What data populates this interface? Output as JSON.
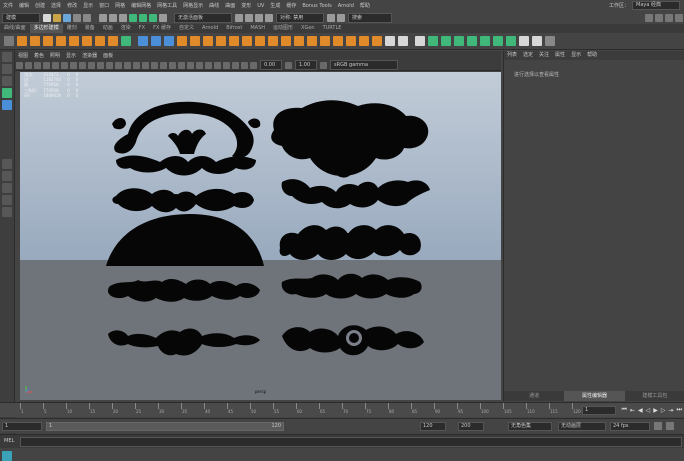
{
  "menubar": {
    "items": [
      "文件",
      "编辑",
      "创建",
      "选择",
      "修改",
      "显示",
      "窗口",
      "网格",
      "编辑网格",
      "网格工具",
      "网格显示",
      "曲线",
      "曲面",
      "变形",
      "UV",
      "生成",
      "缓存",
      "Bonus Tools",
      "Arnold",
      "帮助"
    ],
    "workspace_label": "工作区：",
    "workspace_value": "Maya 经典"
  },
  "statusline": {
    "mode": "建模",
    "unlock_label": "无激活面板",
    "render_label": "对称: 禁用",
    "search_placeholder": "搜索"
  },
  "shelf": {
    "tabs": [
      "曲线/曲面",
      "多边形建模",
      "雕刻",
      "装备",
      "动画",
      "渲染",
      "FX",
      "FX 缓存",
      "自定义",
      "Arnold",
      "Bifrost",
      "MASH",
      "运动图形",
      "XGen",
      "TURTLE"
    ],
    "active_tab": 1
  },
  "viewport": {
    "menu": [
      "视图",
      "着色",
      "照明",
      "显示",
      "渲染器",
      "面板"
    ],
    "field1": "0.00",
    "field2": "1.00",
    "colorspace": "sRGB gamma",
    "camera": "persp",
    "stats": [
      {
        "label": "顶点:",
        "a": "414872",
        "b": "0",
        "c": "0"
      },
      {
        "label": "边:",
        "a": "1182762",
        "b": "0",
        "c": "0"
      },
      {
        "label": "面:",
        "a": "770958",
        "b": "0",
        "c": "0"
      },
      {
        "label": "三角形:",
        "a": "770958",
        "b": "0",
        "c": "0"
      },
      {
        "label": "UV:",
        "a": "1809426",
        "b": "0",
        "c": "0"
      }
    ]
  },
  "right_panel": {
    "tabs": [
      "列表",
      "选定",
      "关注",
      "属性",
      "显示",
      "帮助"
    ],
    "message": "进行选择以查看属性",
    "bottom_tabs": [
      "通道",
      "属性编辑器",
      "建模工具包"
    ],
    "active_bottom": 1
  },
  "timeline": {
    "ticks": [
      "1",
      "5",
      "10",
      "15",
      "20",
      "25",
      "30",
      "35",
      "40",
      "45",
      "50",
      "55",
      "60",
      "65",
      "70",
      "75",
      "80",
      "85",
      "90",
      "95",
      "100",
      "105",
      "110",
      "115",
      "120"
    ],
    "current_frame": "1"
  },
  "range": {
    "start": "1",
    "inner_start": "1",
    "inner_end": "120",
    "end": "120",
    "max": "200",
    "anim_layer": "无角色集",
    "char_set": "无动画层",
    "fps": "24 fps"
  },
  "cmdline": {
    "label": "MEL"
  },
  "colors": {
    "accent_orange": "#e08a2a",
    "accent_green": "#3fb87a",
    "accent_blue": "#4a8fd8",
    "viewport_sky": "#b0bdcc",
    "viewport_ground": "#6f737a"
  }
}
